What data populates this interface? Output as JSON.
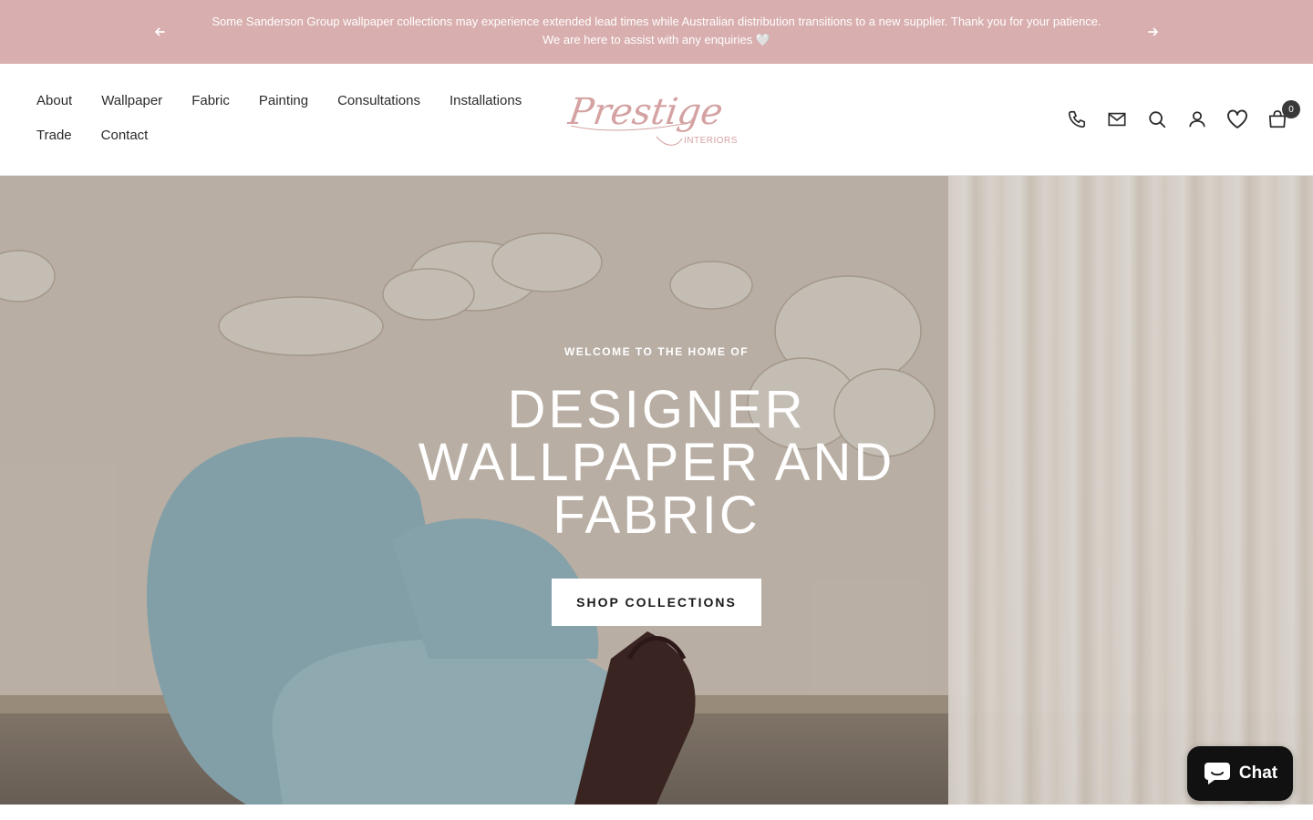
{
  "announcement": {
    "line1": "Some Sanderson Group wallpaper collections may experience extended lead times while Australian distribution transitions to a new supplier. Thank you for your patience.",
    "line2": "We are here to assist with any enquiries 🤍",
    "prev_icon": "arrow-left-icon",
    "next_icon": "arrow-right-icon"
  },
  "nav": {
    "items": [
      {
        "label": "About"
      },
      {
        "label": "Wallpaper"
      },
      {
        "label": "Fabric"
      },
      {
        "label": "Painting"
      },
      {
        "label": "Consultations"
      },
      {
        "label": "Installations"
      },
      {
        "label": "Trade"
      },
      {
        "label": "Contact"
      }
    ]
  },
  "logo": {
    "script": "Prestige",
    "sub": "INTERIORS"
  },
  "header_icons": {
    "phone": "phone-icon",
    "mail": "mail-icon",
    "search": "search-icon",
    "account": "account-icon",
    "wishlist": "heart-icon",
    "cart": "cart-icon",
    "cart_count": "0"
  },
  "hero": {
    "eyebrow": "WELCOME TO THE HOME OF",
    "headline_line1": "DESIGNER",
    "headline_line2": "WALLPAPER AND",
    "headline_line3": "FABRIC",
    "cta_label": "SHOP COLLECTIONS"
  },
  "chat": {
    "label": "Chat",
    "icon": "chat-bubble-icon"
  },
  "colors": {
    "announcement_bg": "#d9aeae",
    "logo_pink": "#d4a2a2",
    "chat_bg": "#111111"
  }
}
